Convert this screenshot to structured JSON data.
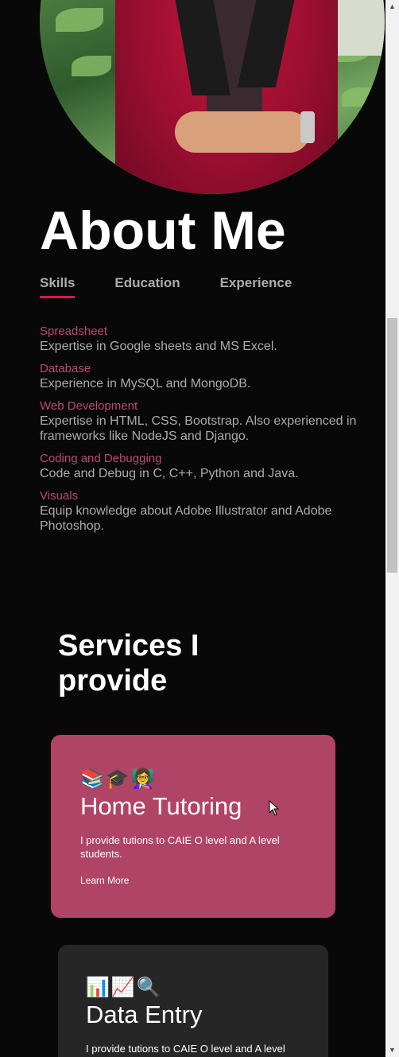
{
  "about": {
    "title": "About Me",
    "tabs": [
      {
        "label": "Skills",
        "active": true
      },
      {
        "label": "Education",
        "active": false
      },
      {
        "label": "Experience",
        "active": false
      }
    ],
    "skills": [
      {
        "name": "Spreadsheet",
        "desc": "Expertise in Google sheets and MS Excel."
      },
      {
        "name": "Database",
        "desc": "Experience in MySQL and MongoDB."
      },
      {
        "name": "Web Development",
        "desc": "Expertise in HTML, CSS, Bootstrap. Also experienced in frameworks like NodeJS and Django."
      },
      {
        "name": "Coding and Debugging",
        "desc": "Code and Debug in C, C++, Python and Java."
      },
      {
        "name": "Visuals",
        "desc": "Equip knowledge about Adobe Illustrator and Adobe Photoshop."
      }
    ]
  },
  "services": {
    "title": "Services I provide",
    "cards": [
      {
        "emojis": "📚🎓👩‍🏫",
        "title": "Home Tutoring",
        "text": "I provide tutions to CAIE O level and A level students.",
        "link": "Learn More"
      },
      {
        "emojis": "📊📈🔍",
        "title": "Data Entry",
        "text": "I provide tutions to CAIE O level and A level students."
      }
    ]
  },
  "colors": {
    "background": "#080808",
    "accent": "#e0144c",
    "skill_name": "#b94a6e",
    "card_primary": "#b04466",
    "card_secondary": "#262626"
  }
}
